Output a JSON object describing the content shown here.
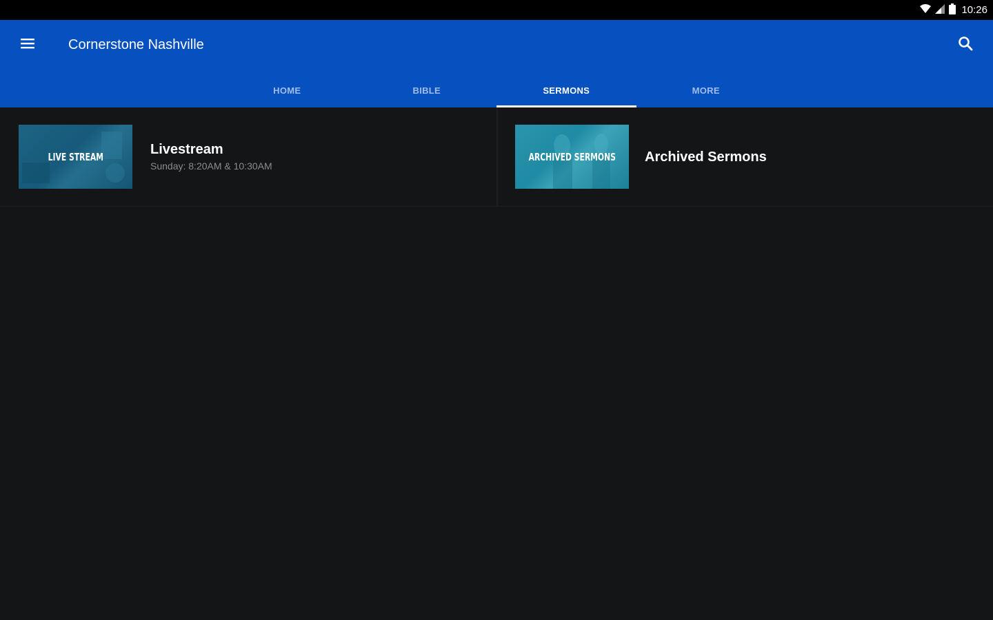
{
  "status_bar": {
    "time": "10:26",
    "icons": [
      "wifi-icon",
      "signal-icon",
      "battery-icon"
    ]
  },
  "app_bar": {
    "title": "Cornerstone Nashville",
    "menu_icon": "menu-icon",
    "search_icon": "search-icon",
    "background": "#0650c0"
  },
  "tabs": [
    {
      "label": "HOME",
      "active": false
    },
    {
      "label": "BIBLE",
      "active": false
    },
    {
      "label": "SERMONS",
      "active": true
    },
    {
      "label": "MORE",
      "active": false
    }
  ],
  "cards": [
    {
      "thumb_text": "LIVE STREAM",
      "title": "Livestream",
      "subtitle": "Sunday: 8:20AM & 10:30AM"
    },
    {
      "thumb_text": "ARCHIVED SERMONS",
      "title": "Archived Sermons"
    }
  ]
}
